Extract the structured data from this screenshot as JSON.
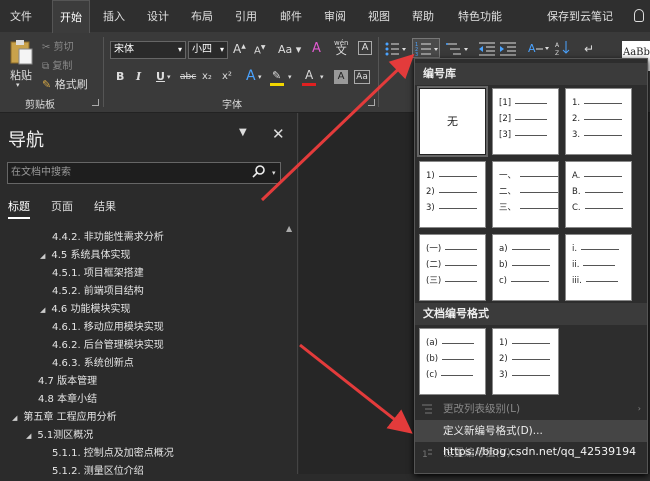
{
  "tabs": [
    "文件",
    "开始",
    "插入",
    "设计",
    "布局",
    "引用",
    "邮件",
    "审阅",
    "视图",
    "帮助",
    "特色功能",
    "保存到云笔记"
  ],
  "active_tab": "开始",
  "clipboard": {
    "paste": "粘贴",
    "cut": "剪切",
    "copy": "复制",
    "format_painter": "格式刷",
    "label": "剪贴板"
  },
  "font": {
    "name": "宋体",
    "size": "小四",
    "label": "字体",
    "grow": "A",
    "shrink": "A",
    "change_case": "Aa",
    "bold": "B",
    "italic": "I",
    "underline": "U",
    "strike": "abc",
    "subscript": "x₂",
    "superscript": "x²",
    "phonetic": "wén",
    "phonetic_char": "文",
    "text_effect": "A",
    "font_color": "A",
    "char_shade": "A",
    "aa": "Aa"
  },
  "styles_preview": "AaBb",
  "nav": {
    "title": "导航",
    "search_placeholder": "在文档中搜索",
    "tabs": [
      "标题",
      "页面",
      "结果"
    ],
    "items": [
      {
        "label": "4.4.2. 非功能性需求分析",
        "arrow": ""
      },
      {
        "label": "4.5 系统具体实现",
        "arrow": "◢"
      },
      {
        "label": "4.5.1. 项目框架搭建",
        "arrow": ""
      },
      {
        "label": "4.5.2. 前端项目结构",
        "arrow": ""
      },
      {
        "label": "4.6 功能模块实现",
        "arrow": "◢"
      },
      {
        "label": "4.6.1. 移动应用模块实现",
        "arrow": ""
      },
      {
        "label": "4.6.2. 后台管理模块实现",
        "arrow": ""
      },
      {
        "label": "4.6.3. 系统创新点",
        "arrow": ""
      },
      {
        "label": "4.7 版本管理",
        "arrow": ""
      },
      {
        "label": "4.8 本章小结",
        "arrow": ""
      },
      {
        "label": "第五章 工程应用分析",
        "arrow": "◢"
      },
      {
        "label": "5.1测区概况",
        "arrow": "◢"
      },
      {
        "label": "5.1.1. 控制点及加密点概况",
        "arrow": ""
      },
      {
        "label": "5.1.2. 测量区位介绍",
        "arrow": ""
      }
    ]
  },
  "numbering_menu": {
    "library_header": "编号库",
    "none_label": "无",
    "library": [
      [],
      [
        "[1]",
        "[2]",
        "[3]"
      ],
      [
        "1.",
        "2.",
        "3."
      ],
      [
        "1)",
        "2)",
        "3)"
      ],
      [
        "一、",
        "二、",
        "三、"
      ],
      [
        "A.",
        "B.",
        "C."
      ],
      [
        "(一)",
        "(二)",
        "(三)"
      ],
      [
        "a)",
        "b)",
        "c)"
      ],
      [
        "i.",
        "ii.",
        "iii."
      ]
    ],
    "doc_header": "文档编号格式",
    "doc_formats": [
      [
        "(a)",
        "(b)",
        "(c)"
      ],
      [
        "1)",
        "2)",
        "3)"
      ]
    ],
    "change_level": "更改列表级别(L)",
    "define_new": "定义新编号格式(D)...",
    "set_value": "设置编号值(V)..."
  },
  "watermark": "https://blog.csdn.net/qq_42539194",
  "colors": {
    "accent_arrow": "#e33b3b",
    "ribbon": "#3a3a3a",
    "highlight": "#f2d600",
    "font_red": "#e02020"
  }
}
